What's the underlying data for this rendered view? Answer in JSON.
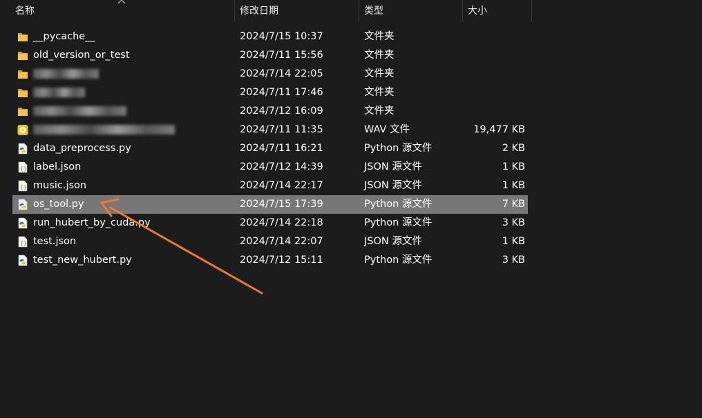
{
  "columns": {
    "name": "名称",
    "date": "修改日期",
    "type": "类型",
    "size": "大小"
  },
  "files": [
    {
      "name": "__pycache__",
      "date": "2024/7/15 10:37",
      "type": "文件夹",
      "size": "",
      "icon": "folder-icon"
    },
    {
      "name": "old_version_or_test",
      "date": "2024/7/11 15:56",
      "type": "文件夹",
      "size": "",
      "icon": "folder-icon"
    },
    {
      "name": "",
      "date": "2024/7/14 22:05",
      "type": "文件夹",
      "size": "",
      "icon": "folder-icon",
      "redacted": true
    },
    {
      "name": "",
      "date": "2024/7/11 17:46",
      "type": "文件夹",
      "size": "",
      "icon": "folder-icon",
      "redacted": true
    },
    {
      "name": "",
      "date": "2024/7/12 16:09",
      "type": "文件夹",
      "size": "",
      "icon": "folder-icon",
      "redacted": true
    },
    {
      "name": "",
      "date": "2024/7/11 11:35",
      "type": "WAV 文件",
      "size": "19,477 KB",
      "icon": "audio-file-icon",
      "redacted": true
    },
    {
      "name": "data_preprocess.py",
      "date": "2024/7/11 16:21",
      "type": "Python 源文件",
      "size": "2 KB",
      "icon": "python-file-icon"
    },
    {
      "name": "label.json",
      "date": "2024/7/12 14:39",
      "type": "JSON 源文件",
      "size": "1 KB",
      "icon": "json-file-icon"
    },
    {
      "name": "music.json",
      "date": "2024/7/14 22:17",
      "type": "JSON 源文件",
      "size": "1 KB",
      "icon": "json-file-icon"
    },
    {
      "name": "os_tool.py",
      "date": "2024/7/15 17:39",
      "type": "Python 源文件",
      "size": "7 KB",
      "icon": "python-file-icon",
      "selected": true
    },
    {
      "name": "run_hubert_by_cuda.py",
      "date": "2024/7/14 22:18",
      "type": "Python 源文件",
      "size": "3 KB",
      "icon": "python-file-icon"
    },
    {
      "name": "test.json",
      "date": "2024/7/14 22:07",
      "type": "JSON 源文件",
      "size": "1 KB",
      "icon": "json-file-icon"
    },
    {
      "name": "test_new_hubert.py",
      "date": "2024/7/12 15:11",
      "type": "Python 源文件",
      "size": "3 KB",
      "icon": "python-file-icon"
    }
  ],
  "colors": {
    "background": "#1c1c1c",
    "selected_row": "#777777",
    "annotation_arrow": "#f07a2a",
    "folder": "#f2c14e"
  }
}
